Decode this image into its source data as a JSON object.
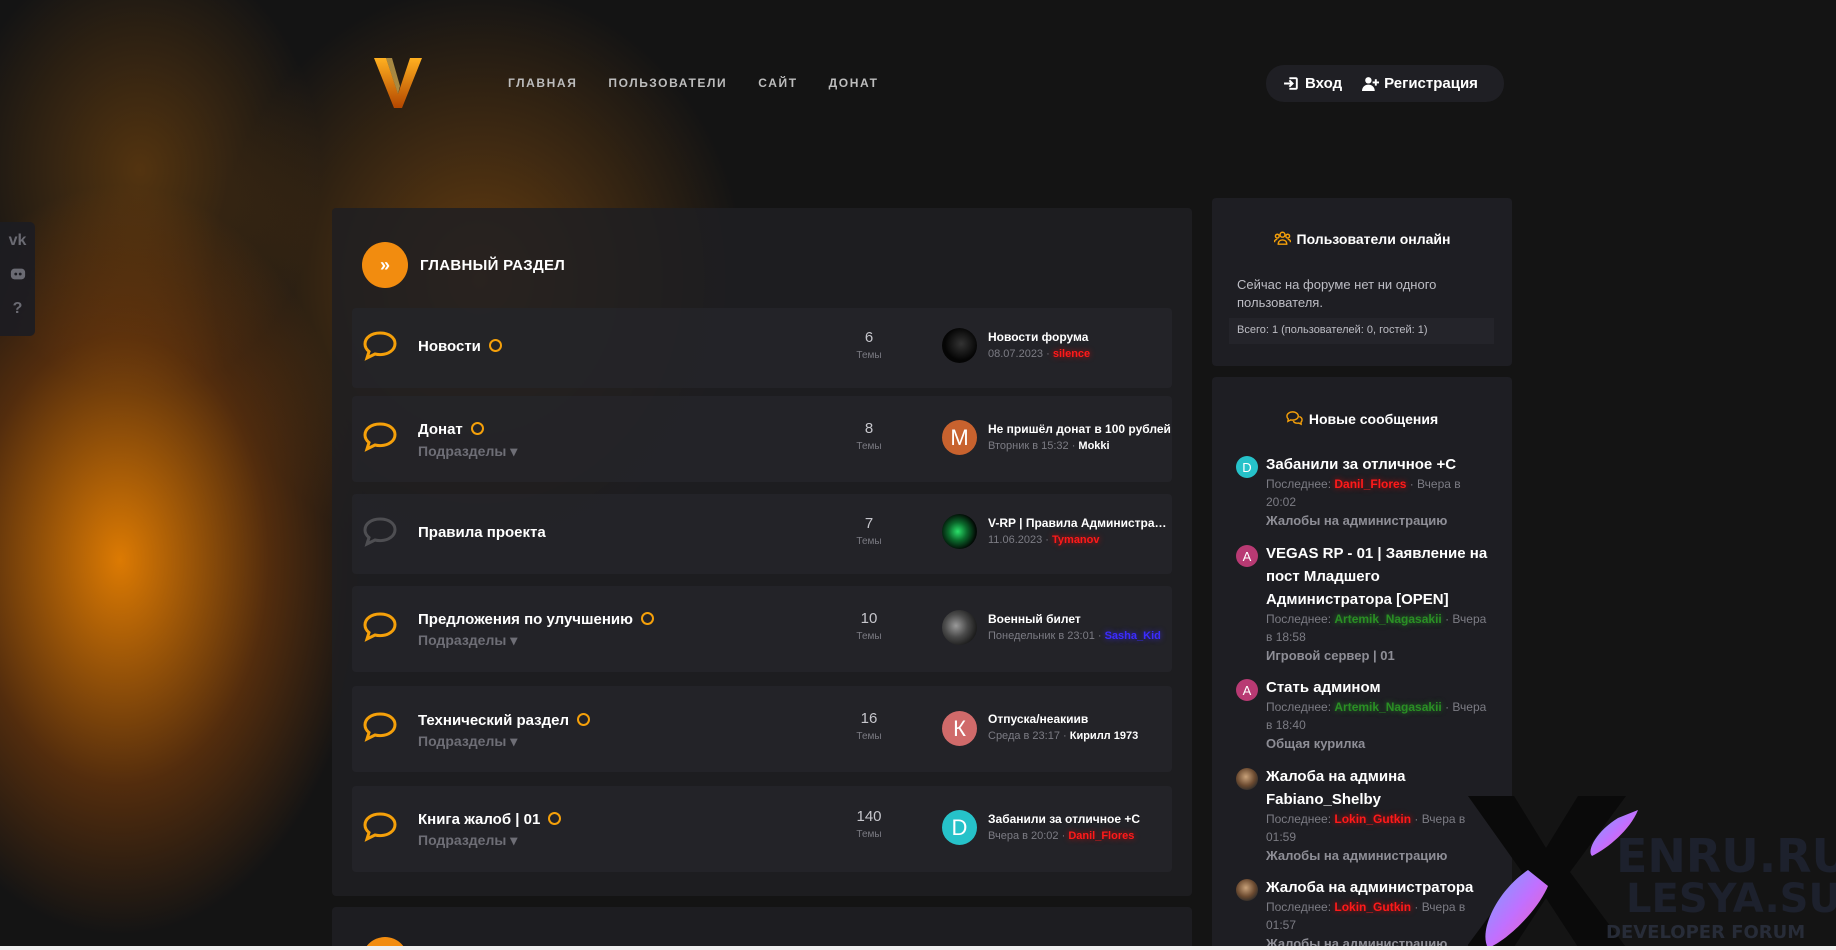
{
  "nav": [
    "ГЛАВНАЯ",
    "ПОЛЬЗОВАТЕЛИ",
    "САЙТ",
    "ДОНАТ"
  ],
  "auth": {
    "login": "Вход",
    "register": "Регистрация"
  },
  "category": {
    "title": "ГЛАВНЫЙ РАЗДЕЛ"
  },
  "stat_label": "Темы",
  "subforums_label": "Подразделы ▾",
  "forums": [
    {
      "title": "Новости",
      "count": "6",
      "last_title": "Новости форума",
      "last_date": "08.07.2023 · ",
      "last_user": "silence",
      "avatar_letter": ""
    },
    {
      "title": "Донат",
      "count": "8",
      "last_title": "Не пришёл донат в 100 рублей",
      "last_date": "Вторник в 15:32 · ",
      "last_user": "Mokki",
      "avatar_letter": "M"
    },
    {
      "title": "Правила проекта",
      "count": "7",
      "last_title": "V-RP | Правила Администрации",
      "last_date": "11.06.2023 · ",
      "last_user": "Tymanov",
      "avatar_letter": ""
    },
    {
      "title": "Предложения по улучшению",
      "count": "10",
      "last_title": "Военный билет",
      "last_date": "Понедельник в 23:01 · ",
      "last_user": "Sasha_Kid",
      "avatar_letter": ""
    },
    {
      "title": "Технический раздел",
      "count": "16",
      "last_title": "Отпуска/неакиив",
      "last_date": "Среда в 23:17 · ",
      "last_user": "Кирилл 1973",
      "avatar_letter": "К"
    },
    {
      "title": "Книга жалоб | 01",
      "count": "140",
      "last_title": "Забанили за отличное +С",
      "last_date": "Вчера в 20:02 · ",
      "last_user": "Danil_Flores",
      "avatar_letter": "D"
    }
  ],
  "online": {
    "title": "Пользователи онлайн",
    "text": "Сейчас на форуме нет ни одного пользователя.",
    "total": "Всего: 1 (пользователей: 0, гостей: 1)"
  },
  "new_messages": {
    "title": "Новые сообщения",
    "items": [
      {
        "avatar": "D",
        "title": "Забанили за отличное +С",
        "prefix": "Последнее: ",
        "user": "Danil_Flores",
        "time": " · Вчера в 20:02",
        "forum": "Жалобы на администрацию"
      },
      {
        "avatar": "A",
        "title": "VEGAS RP - 01 | Заявление на пост Младшего Администратора [OPEN]",
        "prefix": "Последнее: ",
        "user": "Artemik_Nagasakii",
        "time": " · Вчера в 18:58",
        "forum": "Игровой сервер | 01"
      },
      {
        "avatar": "A",
        "title": "Стать админом",
        "prefix": "Последнее: ",
        "user": "Artemik_Nagasakii",
        "time": " · Вчера в 18:40",
        "forum": "Общая курилка"
      },
      {
        "avatar": "",
        "title": "Жалоба на админа Fabiano_Shelby",
        "prefix": "Последнее: ",
        "user": "Lokin_Gutkin",
        "time": " · Вчера в 01:59",
        "forum": "Жалобы на администрацию"
      },
      {
        "avatar": "",
        "title": "Жалоба на администратора",
        "prefix": "Последнее: ",
        "user": "Lokin_Gutkin",
        "time": " · Вчера в 01:57",
        "forum": "Жалобы на администрацию"
      }
    ]
  },
  "watermark": {
    "line1": "ENRU.RU",
    "line2": "LESYA.SU",
    "line3": "DEVELOPER FORUM"
  },
  "colors": {
    "accent": "#f28c0f",
    "panel": "#1e1e23",
    "username_red": "#ff1a1a",
    "username_green": "#2a8f24",
    "username_blue": "#3b2cff"
  }
}
